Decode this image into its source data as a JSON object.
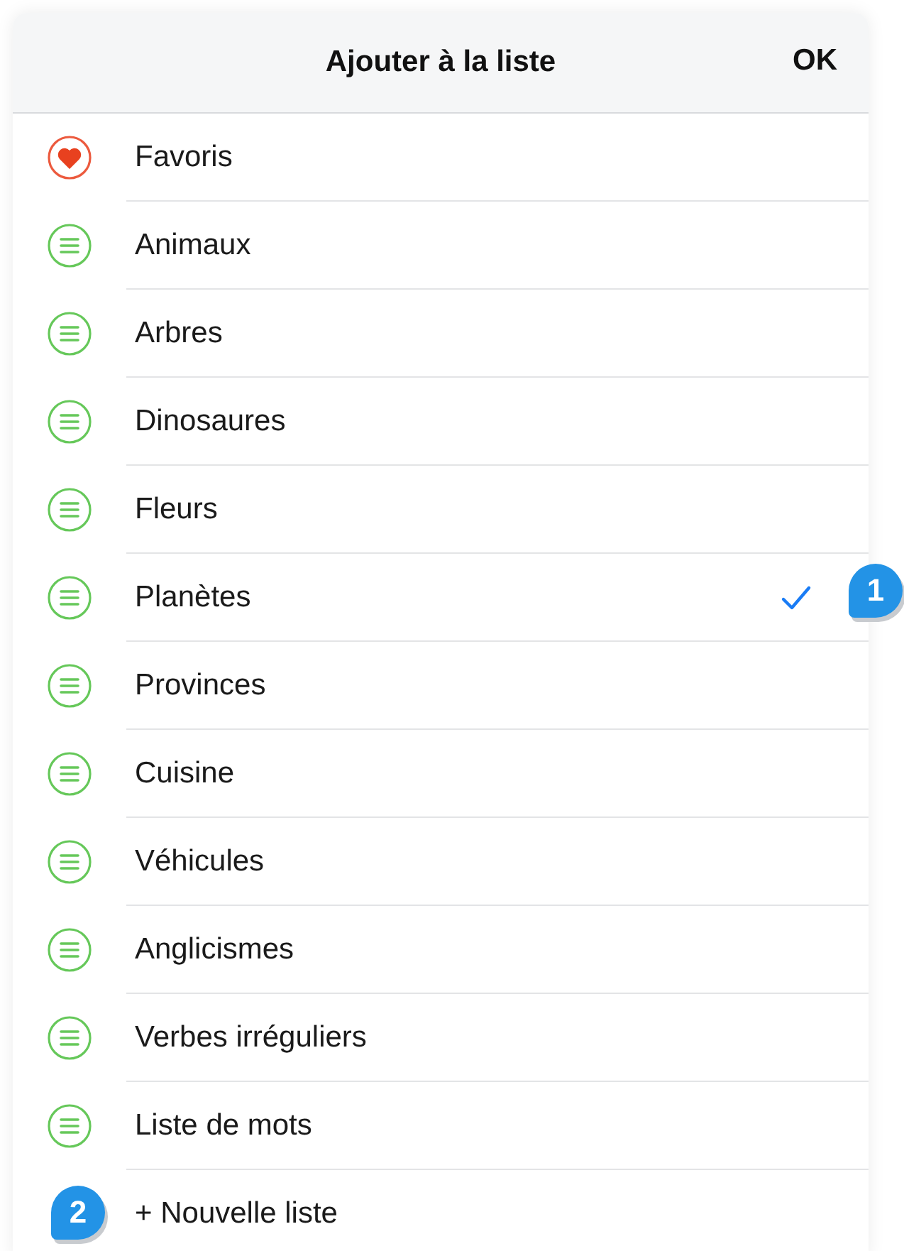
{
  "header": {
    "title": "Ajouter à la liste",
    "done": "OK"
  },
  "rows": [
    {
      "kind": "favorite",
      "label": "Favoris",
      "checked": false
    },
    {
      "kind": "list",
      "label": "Animaux",
      "checked": false
    },
    {
      "kind": "list",
      "label": "Arbres",
      "checked": false
    },
    {
      "kind": "list",
      "label": "Dinosaures",
      "checked": false
    },
    {
      "kind": "list",
      "label": "Fleurs",
      "checked": false
    },
    {
      "kind": "list",
      "label": "Planètes",
      "checked": true,
      "callout": "1"
    },
    {
      "kind": "list",
      "label": "Provinces",
      "checked": false
    },
    {
      "kind": "list",
      "label": "Cuisine",
      "checked": false
    },
    {
      "kind": "list",
      "label": "Véhicules",
      "checked": false
    },
    {
      "kind": "list",
      "label": "Anglicismes",
      "checked": false
    },
    {
      "kind": "list",
      "label": "Verbes irréguliers",
      "checked": false
    },
    {
      "kind": "list",
      "label": "Liste de mots",
      "checked": false
    },
    {
      "kind": "new",
      "label": "+ Nouvelle liste",
      "callout": "2"
    }
  ]
}
